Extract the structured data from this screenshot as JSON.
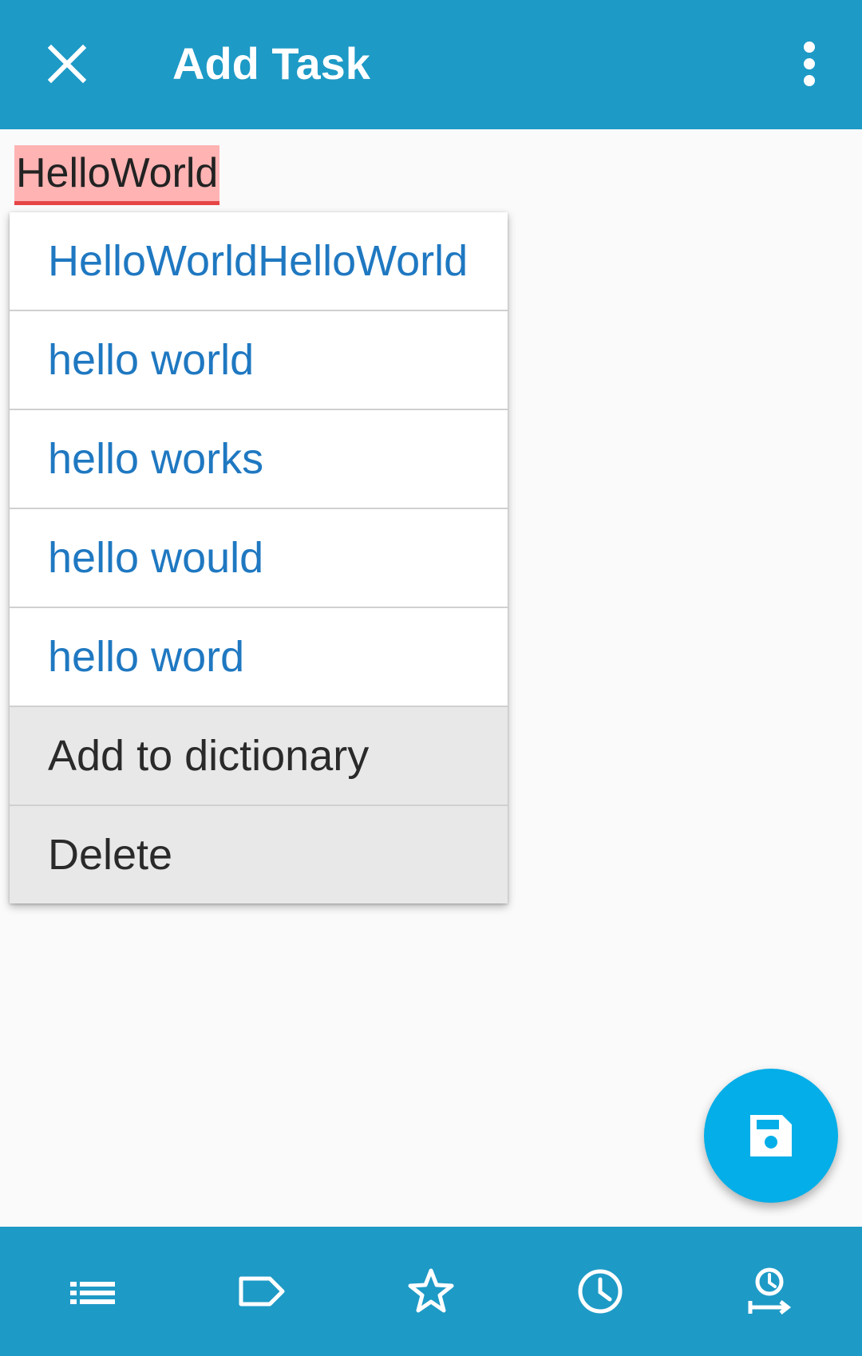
{
  "appbar": {
    "title": "Add Task",
    "close_icon": "close-icon",
    "more_icon": "more-vert-icon",
    "color": "#1e9ac6"
  },
  "task": {
    "text": "HelloWorld",
    "misspelled_highlight": "#ffb3b3",
    "underline_color": "#e64545"
  },
  "spell_menu": {
    "suggestions": [
      "HelloWorldHelloWorld",
      "hello world",
      "hello works",
      "hello would",
      "hello word"
    ],
    "actions": [
      "Add to dictionary",
      "Delete"
    ],
    "suggestion_color": "#1f78c1"
  },
  "fab": {
    "icon": "save-icon",
    "color": "#04aee8"
  },
  "bottom_nav": {
    "icons": [
      "list-icon",
      "label-icon",
      "star-icon",
      "clock-icon",
      "reminder-icon"
    ]
  }
}
